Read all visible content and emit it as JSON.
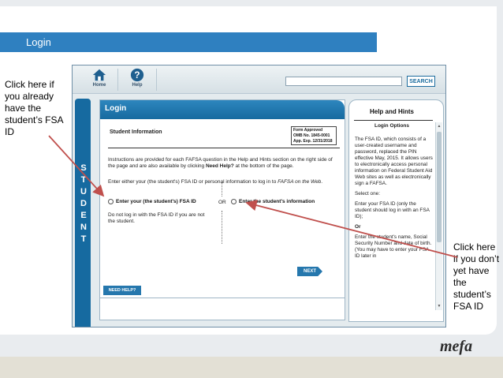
{
  "slide": {
    "title": "Login",
    "callout_left": "Click here if you already have the student’s FSA ID",
    "callout_right": "Click here if you don’t yet have the student’s FSA ID",
    "logo": "mefa",
    "arrow_color": "#c0504d",
    "title_bar_color": "#2f80c0"
  },
  "app": {
    "nav": {
      "home_label": "Home",
      "help_label": "Help",
      "home_icon": "home-icon",
      "help_icon": "help-question-icon"
    },
    "search": {
      "value": "",
      "button_label": "SEARCH"
    },
    "student_tab_letters": [
      "S",
      "T",
      "U",
      "D",
      "E",
      "N",
      "T"
    ],
    "login": {
      "title": "Login",
      "section_title": "Student Information",
      "omb": {
        "line1": "Form Approved",
        "line2": "OMB No. 1845-0001",
        "line3": "App. Exp. 12/31/2018"
      },
      "instructions_part1": "Instructions are provided for each FAFSA question in the Help and Hints section on the right side of the page and are also available by clicking ",
      "instructions_bold": "Need Help?",
      "instructions_part2": " at the bottom of the page.",
      "enter_prompt_part1": "Enter either your (the student's) FSA ID or personal information to log in to ",
      "enter_prompt_italic": "FAFSA on the Web",
      "enter_prompt_part2": ".",
      "option_fsa_id": "Enter your (the student's) FSA ID",
      "option_info": "Enter the student's information",
      "or_label": "OR",
      "warning": "Do not log in with the FSA ID if you are not the student.",
      "next_label": "NEXT",
      "need_help_label": "NEED HELP?"
    },
    "hints": {
      "title": "Help and Hints",
      "subtitle": "Login Options",
      "para1": "The FSA ID, which consists of a user-created username and password, replaced the PIN effective May, 2015. It allows users to electronically access personal information on Federal Student Aid Web sites as well as electronically sign a FAFSA.",
      "para2": "Select one:",
      "para3": "Enter your FSA ID (only the student should log in with an FSA ID);",
      "para4": "Or",
      "para5": "Enter the student's name, Social Security Number and date of birth. (You may have to enter your FSA ID later in"
    }
  }
}
